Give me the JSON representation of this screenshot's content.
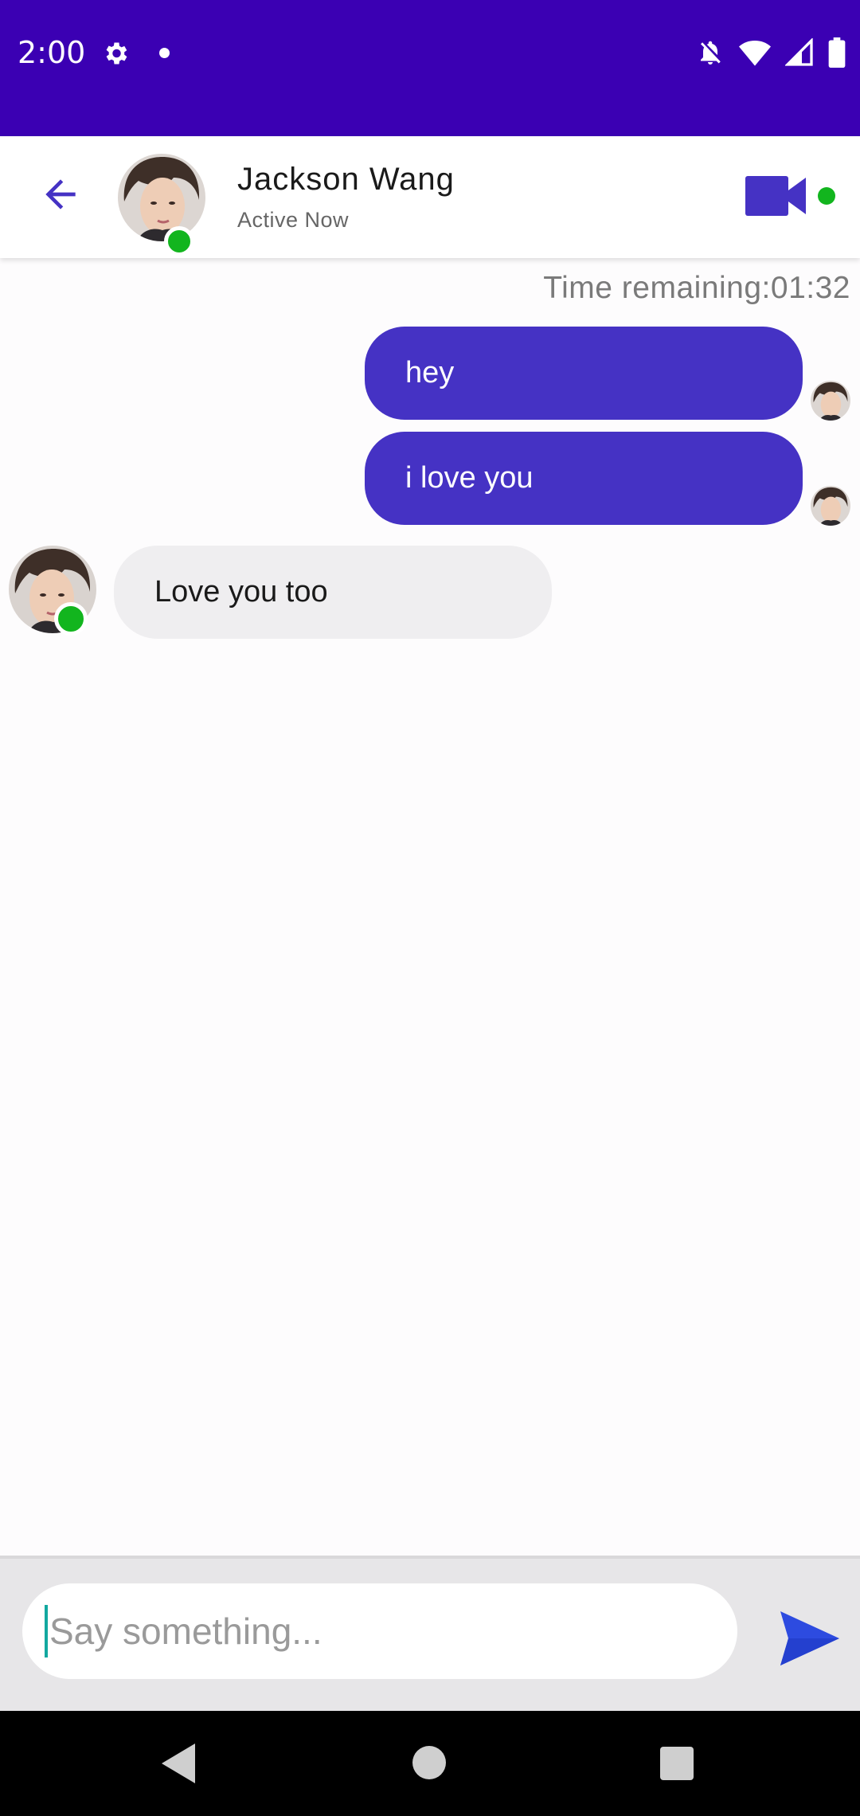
{
  "status_bar": {
    "time": "2:00",
    "icons": [
      "settings-gear-icon",
      "notification-dot-icon",
      "bell-off-icon",
      "wifi-icon",
      "cellular-signal-icon",
      "battery-icon"
    ]
  },
  "header": {
    "contact_name": "Jackson Wang",
    "contact_status": "Active Now",
    "online_color": "#12b51e",
    "accent_color": "#4532c4"
  },
  "chat": {
    "timer_text": "Time remaining:01:32",
    "messages": [
      {
        "direction": "outgoing",
        "text": "hey"
      },
      {
        "direction": "outgoing",
        "text": "i love you"
      },
      {
        "direction": "incoming",
        "text": "Love you too"
      }
    ]
  },
  "composer": {
    "placeholder": "Say something...",
    "value": ""
  },
  "nav": {
    "icons": [
      "back-triangle-icon",
      "home-circle-icon",
      "recents-square-icon"
    ]
  }
}
